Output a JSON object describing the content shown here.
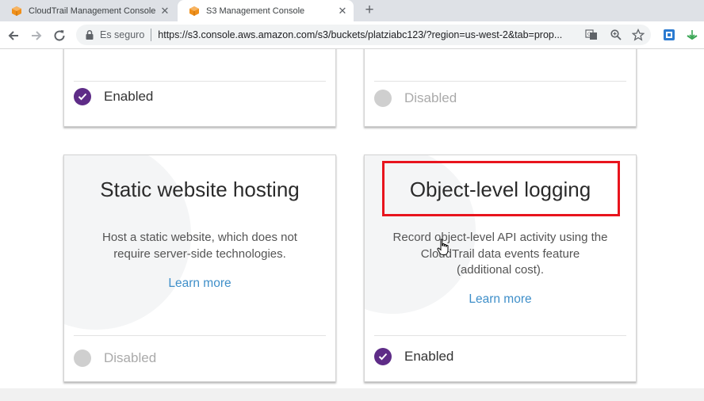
{
  "browser": {
    "tabs": [
      {
        "title": "CloudTrail Management Console",
        "active": false,
        "favicon": "aws-cube-icon"
      },
      {
        "title": "S3 Management Console",
        "active": true,
        "favicon": "aws-cube-icon"
      }
    ],
    "newtab_label": "+",
    "tab_close_label": "✕",
    "secure_label": "Es seguro",
    "url": "https://s3.console.aws.amazon.com/s3/buckets/platziabc123/?region=us-west-2&tab=prop..."
  },
  "colors": {
    "enabled_dot": "#5e2c87",
    "disabled_dot": "#cfcfcf",
    "link": "#3f8fc9",
    "highlight": "#e8141d",
    "aws_orange": "#f0901a"
  },
  "cards_top": [
    {
      "status": "Enabled",
      "enabled": true
    },
    {
      "status": "Disabled",
      "enabled": false
    }
  ],
  "cards_bottom": [
    {
      "title": "Static website hosting",
      "description_lines": [
        "Host a static website, which does not",
        "require server-side technologies."
      ],
      "learn_more": "Learn more",
      "status": "Disabled",
      "enabled": false
    },
    {
      "title": "Object-level logging",
      "description_lines": [
        "Record object-level API activity using the",
        "CloudTrail data events feature",
        "(additional cost)."
      ],
      "learn_more": "Learn more",
      "status": "Enabled",
      "enabled": true
    }
  ]
}
